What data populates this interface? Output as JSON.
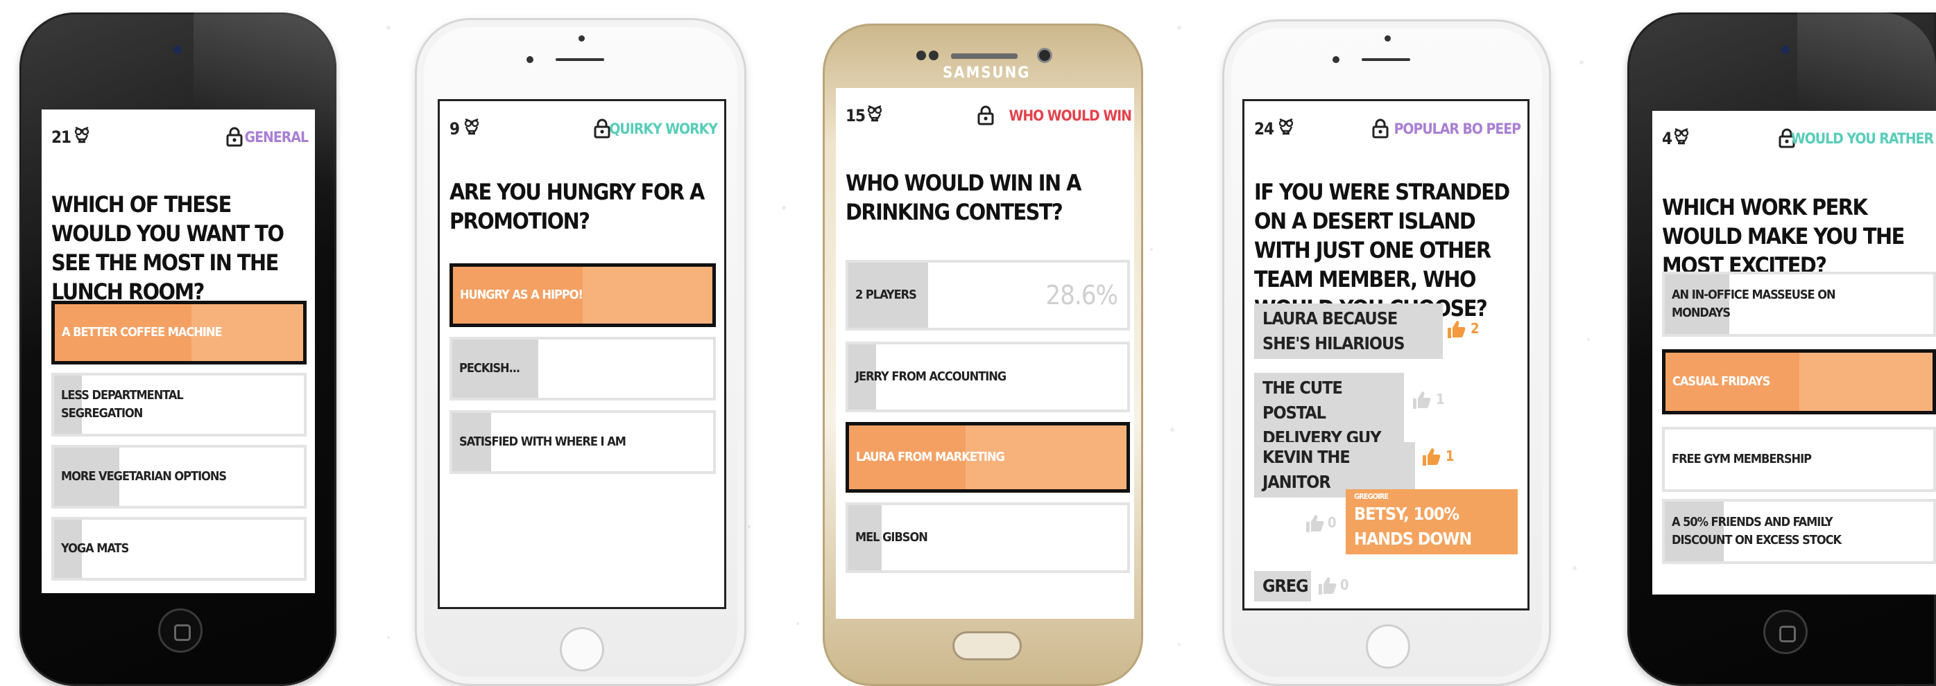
{
  "colors": {
    "general": "#a97fd3",
    "quirky": "#58cdb9",
    "whowouldwin": "#e3434d",
    "popular": "#a97fd3",
    "wouldyourather": "#58cdb9",
    "selected_fill": "#f4a063",
    "thumb_active": "#f39a3e",
    "thumb_inactive": "#d6d6d6"
  },
  "icons": {
    "owl": "owl-icon",
    "lock": "lock-icon",
    "thumb": "thumbs-up-icon"
  },
  "phones": [
    {
      "count": "21",
      "category": "GENERAL",
      "question": "WHICH OF THESE WOULD YOU WANT TO SEE THE MOST IN THE LUNCH ROOM?",
      "options": [
        {
          "label": "A BETTER COFFEE MACHINE",
          "result": 0.55,
          "selected": true
        },
        {
          "label": "LESS DEPARTMENTAL SEGREGATION",
          "result": 0.11
        },
        {
          "label": "MORE VEGETARIAN OPTIONS",
          "result": 0.26
        },
        {
          "label": "YOGA MATS",
          "result": 0.11
        }
      ]
    },
    {
      "count": "9",
      "category": "QUIRKY WORKY",
      "question": "ARE YOU HUNGRY FOR A PROMOTION?",
      "options": [
        {
          "label": "HUNGRY AS A HIPPO!",
          "result": 0.5,
          "selected": true
        },
        {
          "label": "PECKISH...",
          "result": 0.33
        },
        {
          "label": "SATISFIED WITH WHERE I AM",
          "result": 0.15
        }
      ]
    },
    {
      "brand": "SAMSUNG",
      "count": "15",
      "category": "WHO WOULD WIN",
      "question": "WHO WOULD WIN IN A DRINKING CONTEST?",
      "options": [
        {
          "label": "2 PLAYERS",
          "percent": "28.6%",
          "result": 0.286
        },
        {
          "label": "JERRY FROM ACCOUNTING",
          "result": 0.1
        },
        {
          "label": "LAURA FROM MARKETING",
          "result": 0.42,
          "selected": true
        },
        {
          "label": "MEL GIBSON",
          "result": 0.12
        }
      ]
    },
    {
      "count": "24",
      "category": "POPULAR BO PEEP",
      "question": "IF YOU WERE STRANDED ON A DESERT ISLAND WITH JUST ONE OTHER TEAM MEMBER, WHO WOULD YOU CHOOSE?",
      "answers": [
        {
          "text": "LAURA BECAUSE SHE'S HILARIOUS",
          "votes": "2",
          "liked": true
        },
        {
          "text": "THE CUTE POSTAL DELIVERY GUY",
          "votes": "1",
          "liked": false
        },
        {
          "text": "KEVIN THE JANITOR",
          "votes": "1",
          "liked": true
        },
        {
          "text": "BETSY, 100% HANDS DOWN",
          "author": "GREGOIRE",
          "votes": "0",
          "mine": true
        },
        {
          "text": "GREG",
          "votes": "0",
          "liked": false
        }
      ]
    },
    {
      "count": "4",
      "category": "WOULD YOU RATHER",
      "question": "WHICH WORK PERK WOULD MAKE YOU THE MOST EXCITED?",
      "options": [
        {
          "label": "AN IN-OFFICE MASSEUSE ON MONDAYS",
          "result": 0.24
        },
        {
          "label": "CASUAL FRIDAYS",
          "result": 0.5,
          "selected": true
        },
        {
          "label": "FREE GYM MEMBERSHIP",
          "result": 0.0
        },
        {
          "label": "A 50% FRIENDS AND FAMILY DISCOUNT ON EXCESS STOCK",
          "result": 0.22
        }
      ]
    }
  ]
}
